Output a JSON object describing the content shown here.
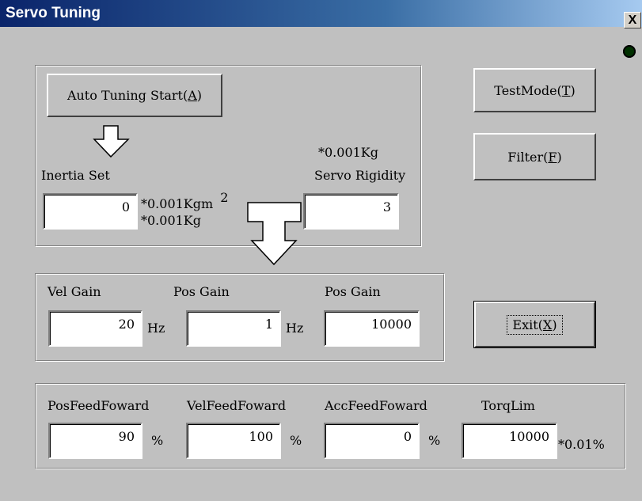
{
  "window": {
    "title": "Servo Tuning",
    "close_label": "X"
  },
  "tuning": {
    "auto_tuning": {
      "label": "Auto Tuning Start(",
      "key": "A",
      "suffix": ")"
    },
    "inertia": {
      "label": "Inertia Set",
      "value": "0",
      "unit_line1": "*0.001Kgm",
      "unit_sup": "2",
      "unit_line2": "*0.001Kg"
    },
    "rigidity": {
      "unit": "*0.001Kg",
      "label": "Servo Rigidity",
      "value": "3"
    }
  },
  "side_buttons": {
    "test_mode": {
      "label": "TestMode(",
      "key": "T",
      "suffix": ")"
    },
    "filter": {
      "label": "Filter(",
      "key": "F",
      "suffix": ")"
    },
    "exit": {
      "label": "Exit(",
      "key": "X",
      "suffix": ")"
    }
  },
  "gains": {
    "vel_gain": {
      "label": "Vel Gain",
      "value": "20",
      "unit": "Hz"
    },
    "pos_gain": {
      "label": "Pos Gain",
      "value": "1",
      "unit": "Hz"
    },
    "pos_gain_2": {
      "label": "Pos Gain",
      "value": "10000"
    }
  },
  "feed_forward": {
    "pos": {
      "label": "PosFeedFoward",
      "value": "90",
      "unit": "%"
    },
    "vel": {
      "label": "VelFeedFoward",
      "value": "100",
      "unit": "%"
    },
    "acc": {
      "label": "AccFeedFoward",
      "value": "0",
      "unit": "%"
    },
    "torq": {
      "label": "TorqLim",
      "value": "10000",
      "unit": "*0.01%"
    }
  }
}
